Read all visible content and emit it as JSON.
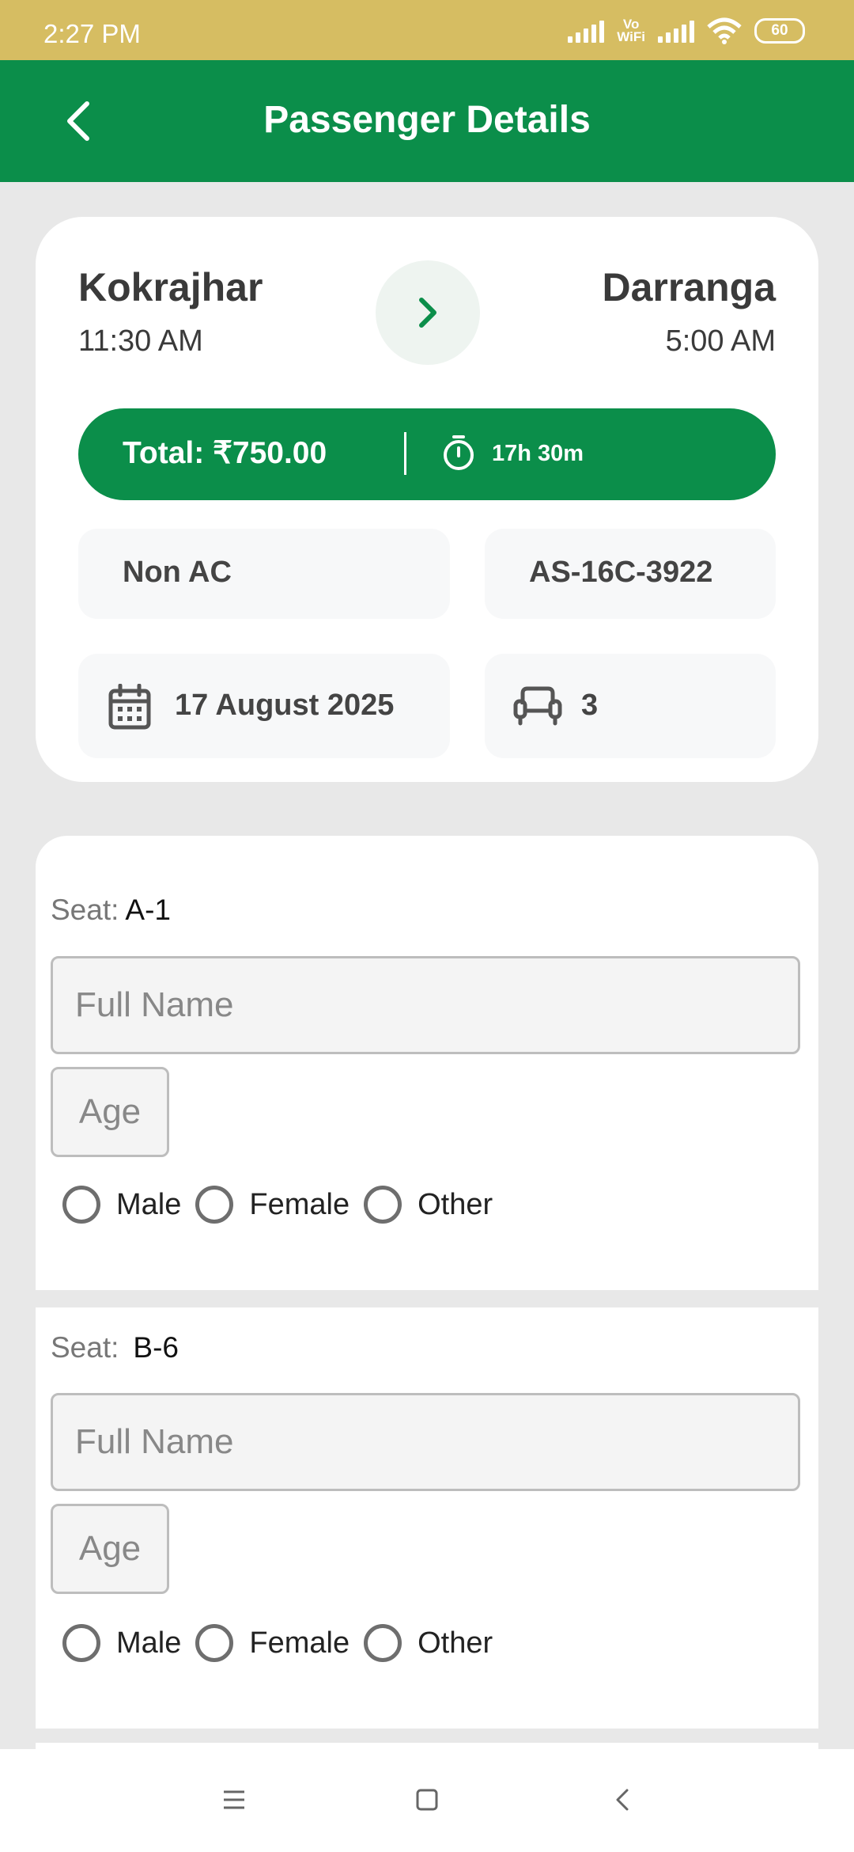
{
  "status_bar": {
    "time": "2:27 PM",
    "vowifi_top": "Vo",
    "vowifi_bottom": "WiFi",
    "battery": "60"
  },
  "app_bar": {
    "title": "Passenger Details",
    "back_icon": "back-arrow-icon"
  },
  "trip": {
    "origin": "Kokrajhar",
    "departure_time": "11:30 AM",
    "destination": "Darranga",
    "arrival_time": "5:00 AM",
    "total": "Total: ₹750.00",
    "duration": "17h 30m",
    "bus_type": "Non AC",
    "bus_number": "AS-16C-3922",
    "date": "17 August 2025",
    "seats_count": "3"
  },
  "passengers": [
    {
      "seat_label": "Seat:",
      "seat_value": "A-1",
      "name_placeholder": "Full Name",
      "age_placeholder": "Age",
      "genders": [
        "Male",
        "Female",
        "Other"
      ]
    },
    {
      "seat_label": "Seat:",
      "seat_value": "B-6",
      "name_placeholder": "Full Name",
      "age_placeholder": "Age",
      "genders": [
        "Male",
        "Female",
        "Other"
      ]
    }
  ],
  "colors": {
    "primary": "#0b8e4a",
    "status_bar": "#d6bd62",
    "background": "#e8e8e8"
  }
}
